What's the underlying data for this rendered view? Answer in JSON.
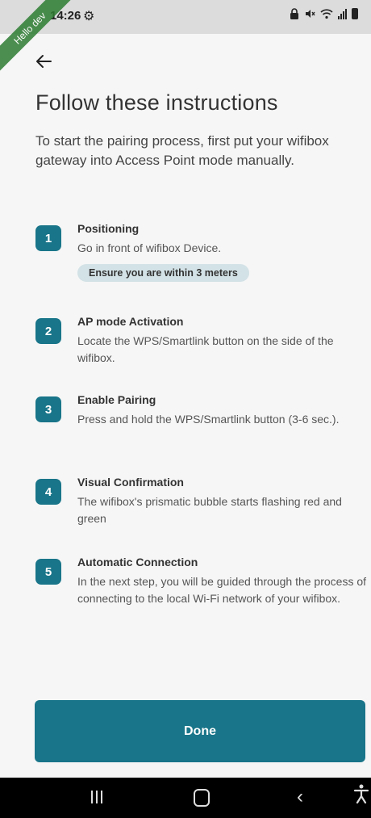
{
  "status_bar": {
    "time": "14:26"
  },
  "debug_banner": "Hello dev",
  "page": {
    "title": "Follow these instructions",
    "intro": "To start the pairing process, first put your wifibox gateway into Access Point mode manually."
  },
  "steps": [
    {
      "number": "1",
      "title": "Positioning",
      "description": "Go in front of wifibox Device.",
      "hint": "Ensure you are within 3 meters"
    },
    {
      "number": "2",
      "title": "AP mode Activation",
      "description": "Locate the WPS/Smartlink button on the side of the wifibox."
    },
    {
      "number": "3",
      "title": "Enable Pairing",
      "description": "Press and hold the WPS/Smartlink button (3-6 sec.)."
    },
    {
      "number": "4",
      "title": "Visual Confirmation",
      "description": "The wifibox's prismatic bubble starts flashing red and green"
    },
    {
      "number": "5",
      "title": "Automatic Connection",
      "description": "In the next step, you will be guided through the process of connecting to the local Wi-Fi network of your wifibox."
    }
  ],
  "actions": {
    "done_label": "Done"
  },
  "colors": {
    "accent": "#197589",
    "hint_bg": "#d3e2e6",
    "background": "#f6f6f6"
  },
  "icons": {
    "back": "arrow-left-icon",
    "settings": "gear-icon",
    "battery": "battery-icon",
    "wifi": "wifi-icon",
    "signal": "signal-icon"
  }
}
